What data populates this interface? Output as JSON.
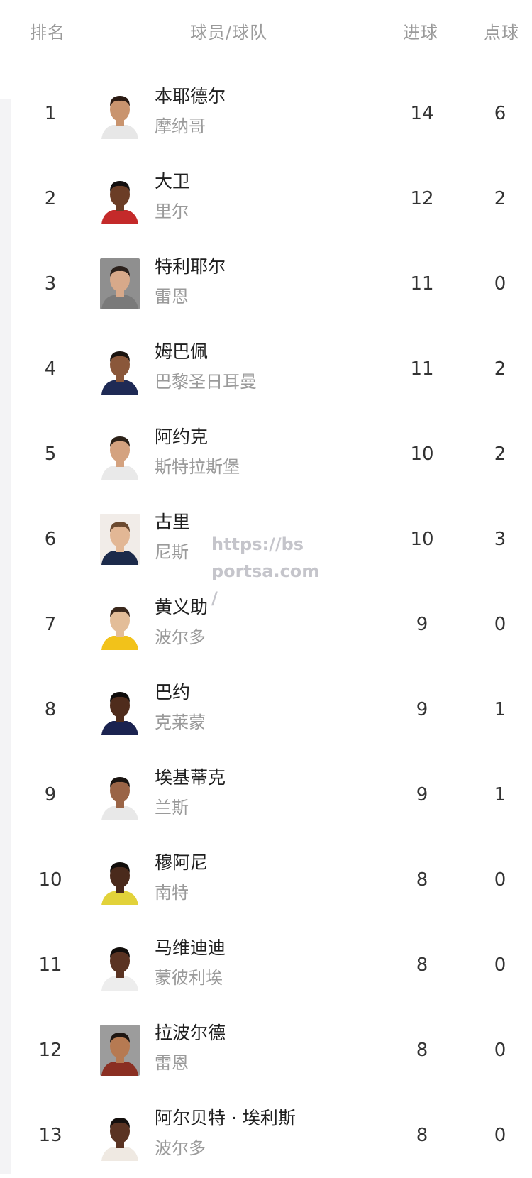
{
  "header": {
    "rank": "排名",
    "player": "球员/球队",
    "goals": "进球",
    "penalties": "点球"
  },
  "players": [
    {
      "rank": "1",
      "name": "本耶德尔",
      "team": "摩纳哥",
      "goals": "14",
      "penalties": "6",
      "skin": "#c9946e",
      "hair": "#2a1a12",
      "shirt": "#e7e7e7",
      "bg": "#ffffff"
    },
    {
      "rank": "2",
      "name": "大卫",
      "team": "里尔",
      "goals": "12",
      "penalties": "2",
      "skin": "#6b3d26",
      "hair": "#141010",
      "shirt": "#c42a2a",
      "bg": "#ffffff"
    },
    {
      "rank": "3",
      "name": "特利耶尔",
      "team": "雷恩",
      "goals": "11",
      "penalties": "0",
      "skin": "#d7a98a",
      "hair": "#2b211c",
      "shirt": "#7a7a7a",
      "bg": "#8f8f8f"
    },
    {
      "rank": "4",
      "name": "姆巴佩",
      "team": "巴黎圣日耳曼",
      "goals": "11",
      "penalties": "2",
      "skin": "#8a573a",
      "hair": "#1b1410",
      "shirt": "#1f2a55",
      "bg": "#ffffff"
    },
    {
      "rank": "5",
      "name": "阿约克",
      "team": "斯特拉斯堡",
      "goals": "10",
      "penalties": "2",
      "skin": "#d4a27f",
      "hair": "#2c2118",
      "shirt": "#e9e9e9",
      "bg": "#ffffff"
    },
    {
      "rank": "6",
      "name": "古里",
      "team": "尼斯",
      "goals": "10",
      "penalties": "3",
      "skin": "#e2b795",
      "hair": "#6b4a30",
      "shirt": "#1c2a4a",
      "bg": "#f1ece8"
    },
    {
      "rank": "7",
      "name": "黄义助",
      "team": "波尔多",
      "goals": "9",
      "penalties": "0",
      "skin": "#e3bd98",
      "hair": "#3a281c",
      "shirt": "#f2c21a",
      "bg": "#ffffff"
    },
    {
      "rank": "8",
      "name": "巴约",
      "team": "克莱蒙",
      "goals": "9",
      "penalties": "1",
      "skin": "#4f2c1c",
      "hair": "#0f0c0b",
      "shirt": "#1b2350",
      "bg": "#ffffff"
    },
    {
      "rank": "9",
      "name": "埃基蒂克",
      "team": "兰斯",
      "goals": "9",
      "penalties": "1",
      "skin": "#9a6446",
      "hair": "#1a1411",
      "shirt": "#e8e8e8",
      "bg": "#ffffff"
    },
    {
      "rank": "10",
      "name": "穆阿尼",
      "team": "南特",
      "goals": "8",
      "penalties": "0",
      "skin": "#4a2a1c",
      "hair": "#120e0c",
      "shirt": "#e2d23a",
      "bg": "#ffffff"
    },
    {
      "rank": "11",
      "name": "马维迪迪",
      "team": "蒙彼利埃",
      "goals": "8",
      "penalties": "0",
      "skin": "#5a3322",
      "hair": "#120e0c",
      "shirt": "#ededed",
      "bg": "#ffffff"
    },
    {
      "rank": "12",
      "name": "拉波尔德",
      "team": "雷恩",
      "goals": "8",
      "penalties": "0",
      "skin": "#b67a52",
      "hair": "#1e1612",
      "shirt": "#8a2f22",
      "bg": "#9c9c9c"
    },
    {
      "rank": "13",
      "name": "阿尔贝特 · 埃利斯",
      "team": "波尔多",
      "goals": "8",
      "penalties": "0",
      "skin": "#5a3322",
      "hair": "#140f0d",
      "shirt": "#efe9e2",
      "bg": "#ffffff"
    }
  ],
  "watermark": {
    "line1": "https://bs",
    "line2": "portsa.com",
    "line3": "/"
  }
}
